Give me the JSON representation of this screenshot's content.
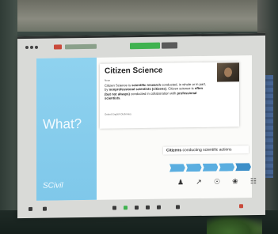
{
  "slide": {
    "left_heading": "What?",
    "logo": "SCivil",
    "card_title": "Citizen Science",
    "card_sub": "Noun",
    "card_body": [
      {
        "text": "Citizen Science is ",
        "bold": false
      },
      {
        "text": "scientific research",
        "bold": true
      },
      {
        "text": " conducted, in whole or in part, by ",
        "bold": false
      },
      {
        "text": "nonprofessional scientists (citizens)",
        "bold": true
      },
      {
        "text": ". Citizen science is ",
        "bold": false
      },
      {
        "text": "often (but not always)",
        "bold": true
      },
      {
        "text": " conducted in collaboration with ",
        "bold": false
      },
      {
        "text": "professional scientists",
        "bold": true
      },
      {
        "text": ".",
        "bold": false
      }
    ],
    "card_footer": "Oxford English Dictionary",
    "quote_bold": "Citizens",
    "quote_rest": " conducting scientific actions",
    "step_count": 5,
    "icons": [
      "people-icon",
      "chart-icon",
      "lightbulb-icon",
      "brain-icon",
      "clipboard-icon"
    ],
    "icon_glyphs": [
      "♟",
      "↗",
      "☉",
      "❀",
      "☷"
    ]
  },
  "colors": {
    "slide_left": "#8fd2ef",
    "share_tab": "#3fb24f",
    "steps": "#5aaee0"
  }
}
